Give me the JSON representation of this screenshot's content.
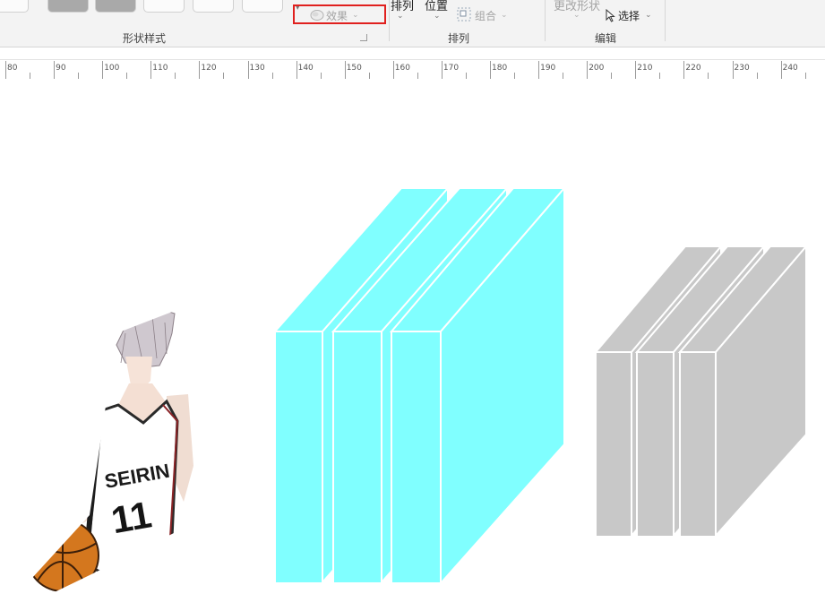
{
  "ribbon": {
    "shape_styles_label": "形状样式",
    "effects_label": "效果",
    "arrange_button_label": "排列",
    "position_button_label": "位置",
    "group_label": "组合",
    "arrange_group_label": "排列",
    "change_shape_label": "更改形状",
    "select_label": "选择",
    "edit_group_label": "编辑",
    "highlight_color": "#e0201e"
  },
  "ruler": {
    "ticks": [
      "80",
      "90",
      "100",
      "110",
      "120",
      "130",
      "140",
      "150",
      "160",
      "170",
      "180",
      "190",
      "200",
      "210",
      "220",
      "230",
      "240"
    ]
  },
  "canvas": {
    "image_jersey_text": "SEIRIN",
    "image_jersey_number": "11",
    "cyan_color": "#80ffff",
    "gray_color": "#c8c8c8"
  }
}
